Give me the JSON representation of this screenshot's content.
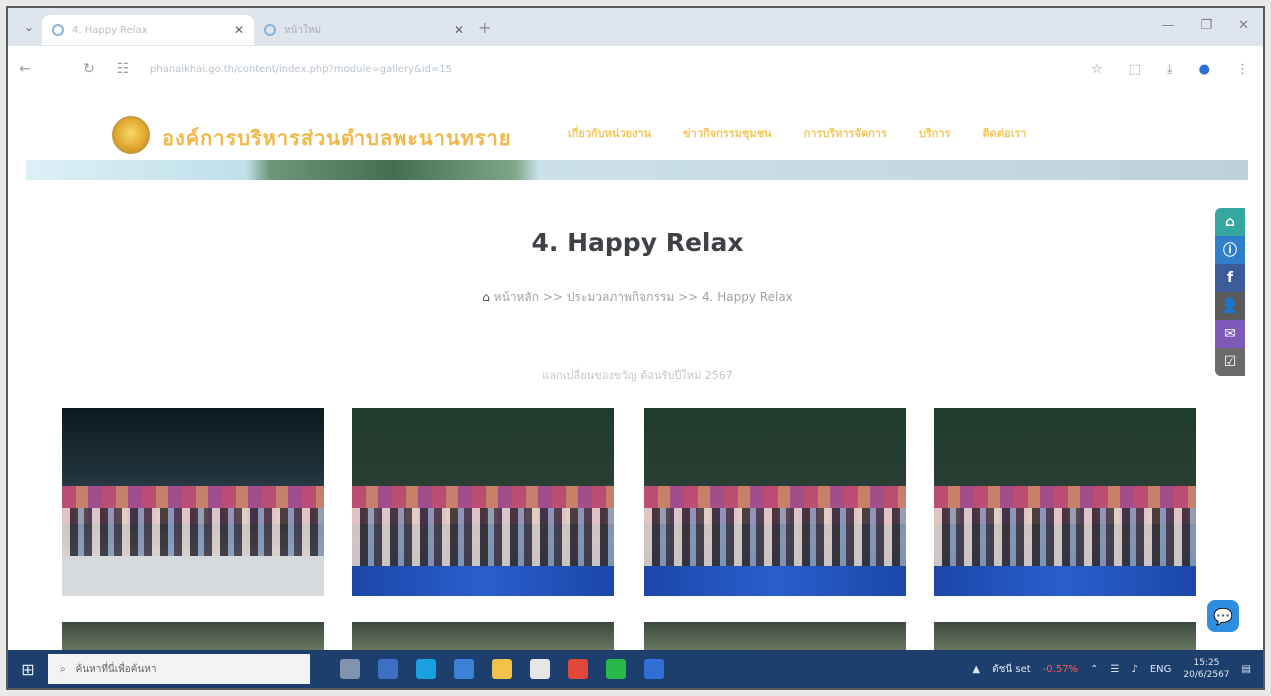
{
  "browser": {
    "tabs": [
      {
        "title": "4. Happy Relax",
        "active": true
      },
      {
        "title": "หน้าใหม่",
        "active": false
      }
    ],
    "url": "phanaikhai.go.th/content/index.php?module=gallery&id=15",
    "new_tab_symbol": "+"
  },
  "site": {
    "title": "องค์การบริหารส่วนตำบลพะนานทราย",
    "menu": [
      "เกี่ยวกับหน่วยงาน",
      "ข่าวกิจกรรมชุมชน",
      "การบริหารจัดการ",
      "บริการ",
      "ติดต่อเรา"
    ]
  },
  "page": {
    "title": "4. Happy Relax",
    "breadcrumb": [
      "หน้าหลัก",
      ">>",
      "ประมวลภาพกิจกรรม",
      ">>",
      "4. Happy Relax"
    ],
    "caption": "แลกเปลี่ยนของขวัญ ต้อนรับปีใหม่ 2567"
  },
  "taskbar": {
    "search_placeholder": "ค้นหาที่นี่เพื่อค้นหา",
    "stock_label": "ดัชนี set",
    "stock_change": "-0.57%",
    "language": "ENG",
    "time": "15:25",
    "date": "20/6/2567"
  },
  "colors": {
    "accent_gold": "#f0b84a",
    "taskbar": "#1c3f6e",
    "messenger": "#2f8de0"
  }
}
